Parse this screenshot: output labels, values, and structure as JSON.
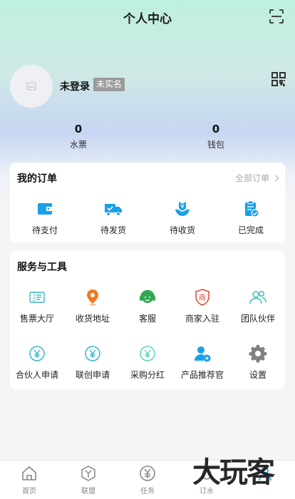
{
  "header": {
    "title": "个人中心",
    "scan_icon": "scan-icon",
    "qr_icon": "qrcode-icon"
  },
  "user": {
    "avatar_icon": "image-placeholder-icon",
    "name": "未登录",
    "badge": "未实名"
  },
  "stats": [
    {
      "value": "0",
      "label": "水票"
    },
    {
      "value": "0",
      "label": "钱包"
    }
  ],
  "orders": {
    "title": "我的订单",
    "all_label": "全部订单",
    "items": [
      {
        "label": "待支付",
        "icon": "wallet-icon"
      },
      {
        "label": "待发货",
        "icon": "truck-icon"
      },
      {
        "label": "待收货",
        "icon": "receive-icon"
      },
      {
        "label": "已完成",
        "icon": "clipboard-check-icon"
      }
    ]
  },
  "services": {
    "title": "服务与工具",
    "items": [
      {
        "label": "售票大厅",
        "icon": "ticket-icon"
      },
      {
        "label": "收货地址",
        "icon": "location-icon"
      },
      {
        "label": "客服",
        "icon": "customer-service-icon"
      },
      {
        "label": "商家入驻",
        "icon": "merchant-icon"
      },
      {
        "label": "团队伙伴",
        "icon": "team-icon"
      },
      {
        "label": "合伙人申请",
        "icon": "yen-coin-icon"
      },
      {
        "label": "联创申请",
        "icon": "yen-coin-icon"
      },
      {
        "label": "采购分红",
        "icon": "yen-coin-icon"
      },
      {
        "label": "产品推荐官",
        "icon": "recommender-icon"
      },
      {
        "label": "设置",
        "icon": "gear-icon"
      }
    ]
  },
  "tabbar": [
    {
      "label": "首页",
      "icon": "home-icon"
    },
    {
      "label": "联盟",
      "icon": "cube-icon"
    },
    {
      "label": "任务",
      "icon": "yen-circle-icon"
    },
    {
      "label": "订水",
      "icon": "water-order-icon"
    },
    {
      "label": "",
      "icon": "profile-icon"
    }
  ],
  "watermark": "大玩客",
  "colors": {
    "accent_blue": "#1aa0e8",
    "orange": "#f07b24",
    "green": "#2ea84f",
    "teal": "#3cc0b0",
    "gray": "#888888"
  }
}
